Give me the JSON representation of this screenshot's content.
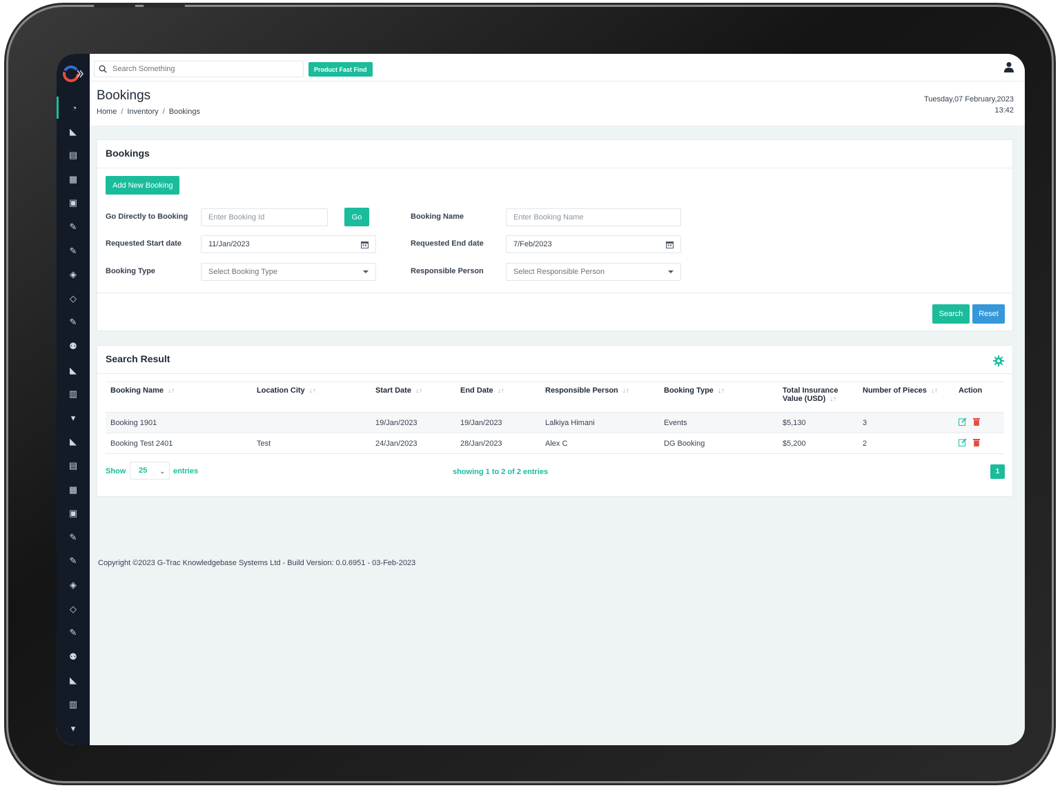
{
  "search": {
    "placeholder": "Search Something",
    "fast_find_label": "Product Fast Find"
  },
  "header": {
    "title": "Bookings",
    "breadcrumb": [
      "Home",
      "Inventory",
      "Bookings"
    ],
    "date": "Tuesday,07 February,2023",
    "time": "13:42"
  },
  "filter_card": {
    "title": "Bookings",
    "add_button": "Add New Booking",
    "go_direct_label": "Go Directly to Booking",
    "booking_id_placeholder": "Enter Booking Id",
    "go_button": "Go",
    "booking_name_label": "Booking Name",
    "booking_name_placeholder": "Enter Booking Name",
    "start_date_label": "Requested Start date",
    "start_date_value": "11/Jan/2023",
    "end_date_label": "Requested End date",
    "end_date_value": "7/Feb/2023",
    "booking_type_label": "Booking Type",
    "booking_type_value": "Select Booking Type",
    "responsible_label": "Responsible Person",
    "responsible_value": "Select Responsible Person",
    "search_button": "Search",
    "reset_button": "Reset"
  },
  "results": {
    "title": "Search Result",
    "columns": [
      "Booking Name",
      "Location City",
      "Start Date",
      "End Date",
      "Responsible Person",
      "Booking Type",
      "Total Insurance Value (USD)",
      "Number of Pieces",
      "Action"
    ],
    "rows": [
      {
        "name": "Booking 1901",
        "city": "",
        "start": "19/Jan/2023",
        "end": "19/Jan/2023",
        "person": "Lalkiya Himani",
        "type": "Events",
        "value": "$5,130",
        "pieces": "3"
      },
      {
        "name": "Booking Test 2401",
        "city": "Test",
        "start": "24/Jan/2023",
        "end": "28/Jan/2023",
        "person": "Alex C",
        "type": "DG Booking",
        "value": "$5,200",
        "pieces": "2"
      }
    ],
    "show_label": "Show",
    "page_size": "25",
    "entries_label": "entries",
    "showing_text": "showing 1 to 2 of 2 entries",
    "current_page": "1"
  },
  "footer": {
    "copyright": "Copyright ©2023 G-Trac Knowledgebase Systems Ltd - Build Version: 0.0.6951 - 03-Feb-2023"
  },
  "colors": {
    "accent": "#1abc9c",
    "reset": "#3498db",
    "sidebar": "#131a28",
    "delete": "#e74c3c"
  },
  "sidebar_icons": [
    "dashboard-icon",
    "chart-icon",
    "report-icon",
    "grid-icon",
    "calendar-icon",
    "edit-icon",
    "edit-icon",
    "box-icon",
    "tag-icon",
    "edit-icon",
    "users-icon",
    "chart-icon",
    "book-icon",
    "map-pin-icon",
    "chart-icon",
    "report-icon",
    "grid-icon",
    "calendar-icon",
    "edit-icon",
    "edit-icon",
    "box-icon",
    "tag-icon",
    "edit-icon",
    "users-icon",
    "chart-icon",
    "book-icon",
    "map-pin-icon"
  ]
}
